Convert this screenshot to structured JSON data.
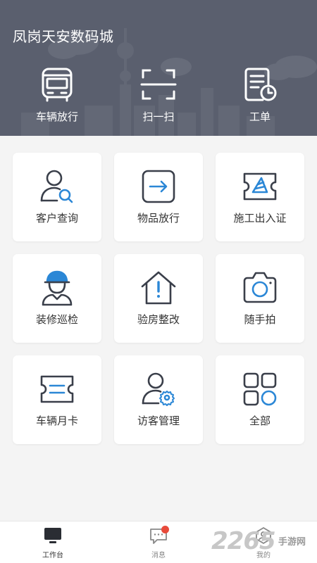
{
  "header": {
    "title": "凤岗天安数码城",
    "quick_actions": [
      {
        "label": "车辆放行",
        "icon": "bus-icon"
      },
      {
        "label": "扫一扫",
        "icon": "scan-icon"
      },
      {
        "label": "工单",
        "icon": "work-order-icon"
      }
    ]
  },
  "grid": {
    "items": [
      {
        "label": "客户查询",
        "icon": "customer-search-icon"
      },
      {
        "label": "物品放行",
        "icon": "item-release-icon"
      },
      {
        "label": "施工出入证",
        "icon": "construction-pass-icon"
      },
      {
        "label": "装修巡检",
        "icon": "worker-helmet-icon"
      },
      {
        "label": "验房整改",
        "icon": "house-alert-icon"
      },
      {
        "label": "随手拍",
        "icon": "camera-icon"
      },
      {
        "label": "车辆月卡",
        "icon": "monthly-card-icon"
      },
      {
        "label": "访客管理",
        "icon": "visitor-settings-icon"
      },
      {
        "label": "全部",
        "icon": "all-apps-icon"
      }
    ]
  },
  "tabbar": {
    "tabs": [
      {
        "label": "工作台",
        "icon": "monitor-icon",
        "active": true
      },
      {
        "label": "消息",
        "icon": "message-icon",
        "badge": true
      },
      {
        "label": "我的",
        "icon": "profile-icon"
      }
    ]
  },
  "watermark": {
    "number": "2265",
    "text": "手游网"
  },
  "colors": {
    "header_bg": "#5a5f6e",
    "icon_dark": "#3a3f4a",
    "icon_accent": "#2b87d6",
    "badge": "#e84a3a"
  }
}
